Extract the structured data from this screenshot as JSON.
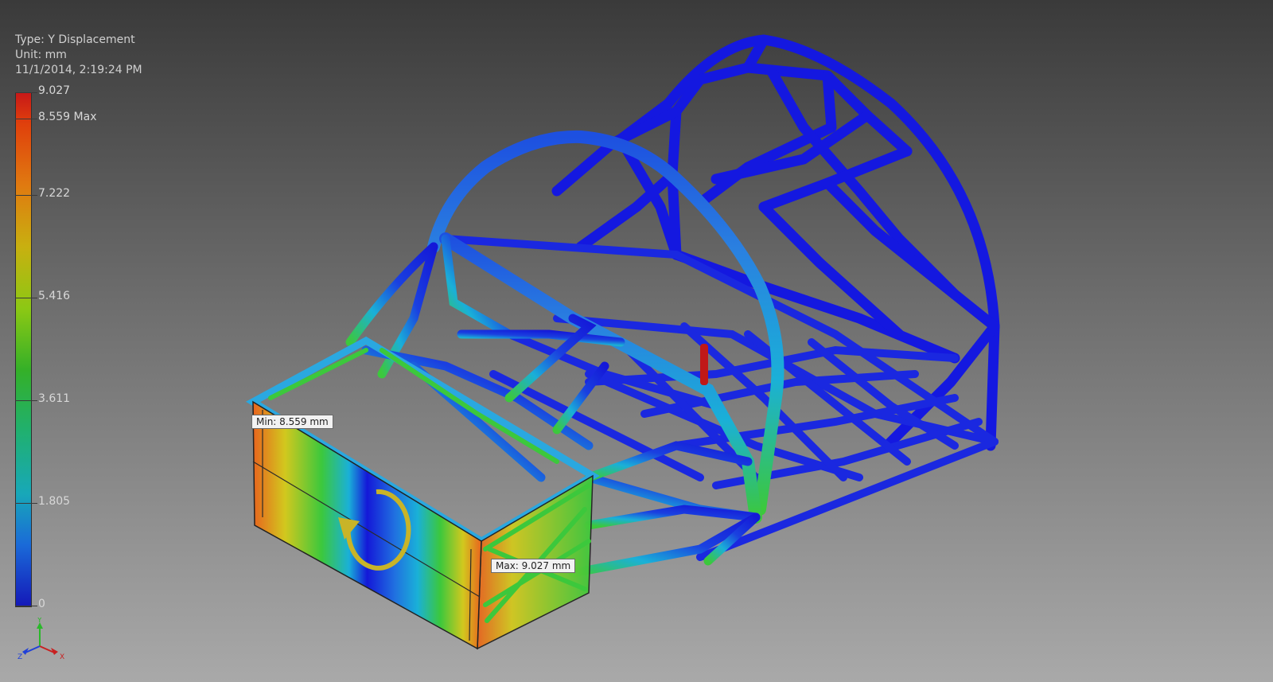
{
  "legend": {
    "type_text": "Type: Y Displacement",
    "unit_text": "Unit: mm",
    "timestamp": "11/1/2014, 2:19:24 PM",
    "ticks": [
      {
        "label": "9.027",
        "value": 9.027
      },
      {
        "label": "8.559 Max",
        "value": 8.559
      },
      {
        "label": "7.222",
        "value": 7.222
      },
      {
        "label": "5.416",
        "value": 5.416
      },
      {
        "label": "3.611",
        "value": 3.611
      },
      {
        "label": "1.805",
        "value": 1.805
      },
      {
        "label": "0",
        "value": 0
      }
    ],
    "range": [
      0,
      9.027
    ]
  },
  "probes": {
    "min_label": "Min: 8.559 mm",
    "max_label": "Max: 9.027 mm"
  },
  "triad": {
    "x": "X",
    "y": "Y",
    "z": "Z"
  },
  "colors": {
    "deep_blue": "#1418d8",
    "light_blue": "#2aa8e0",
    "green": "#3cc83c",
    "yellow": "#d2c81e",
    "orange": "#e8641e",
    "red": "#c81e1e",
    "rotate_arrow": "#c8b428"
  }
}
